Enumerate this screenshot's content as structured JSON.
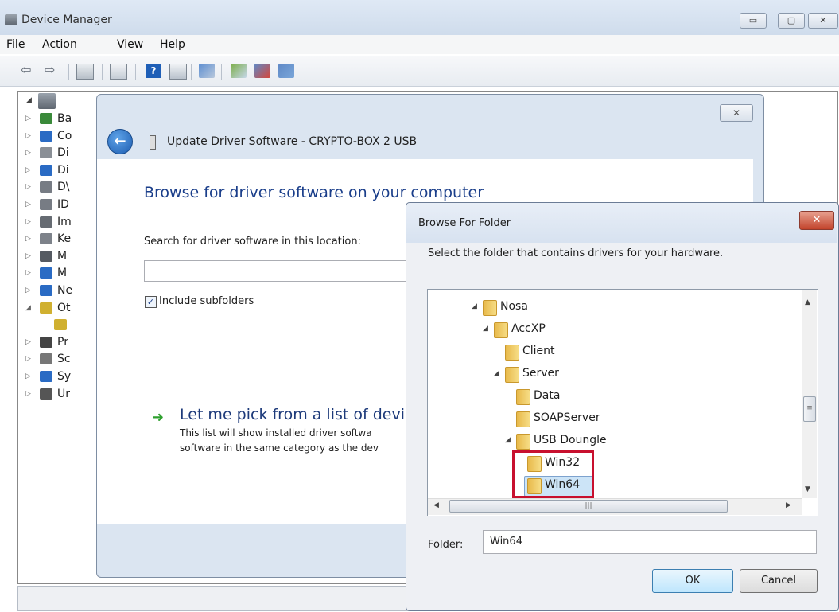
{
  "device_manager": {
    "title": "Device Manager",
    "menu": [
      "File",
      "Action",
      "View",
      "Help"
    ],
    "tree_items": [
      {
        "label": "Ba",
        "color": "#3a8a3a"
      },
      {
        "label": "Co",
        "color": "#2a6bc4"
      },
      {
        "label": "Di",
        "color": "#8a8f96"
      },
      {
        "label": "Di",
        "color": "#2a6bc4"
      },
      {
        "label": "D\\",
        "color": "#777c84"
      },
      {
        "label": "ID",
        "color": "#777c84"
      },
      {
        "label": "Im",
        "color": "#666b72"
      },
      {
        "label": "Ke",
        "color": "#7d828a"
      },
      {
        "label": "M",
        "color": "#555a62"
      },
      {
        "label": "M",
        "color": "#2a6bc4"
      },
      {
        "label": "Ne",
        "color": "#2a6bc4"
      },
      {
        "label": "Ot",
        "color": "#d0b030"
      },
      {
        "label": "",
        "color": "#d0b030"
      },
      {
        "label": "Pr",
        "color": "#444"
      },
      {
        "label": "Sc",
        "color": "#777"
      },
      {
        "label": "Sy",
        "color": "#2a6bc4"
      },
      {
        "label": "Ur",
        "color": "#555"
      }
    ]
  },
  "update_driver": {
    "title": "Update Driver Software - CRYPTO-BOX 2 USB",
    "heading": "Browse for driver software on your computer",
    "search_label": "Search for driver software in this location:",
    "include_subfolders": "Include subfolders",
    "close_glyph": "✕",
    "link_text": "Let me pick from a list of devic",
    "desc_line1": "This list will show installed driver softwa",
    "desc_line2": "software in the same category as the dev"
  },
  "browse_folder": {
    "title": "Browse For Folder",
    "instruction": "Select the folder that contains drivers for your hardware.",
    "close_glyph": "✕",
    "tree": [
      {
        "label": "Nosa",
        "expanded": true
      },
      {
        "label": "AccXP",
        "expanded": true
      },
      {
        "label": "Client",
        "expanded": false
      },
      {
        "label": "Server",
        "expanded": true
      },
      {
        "label": "Data",
        "expanded": false
      },
      {
        "label": "SOAPServer",
        "expanded": false
      },
      {
        "label": "USB Doungle",
        "expanded": true
      },
      {
        "label": "Win32",
        "expanded": false
      },
      {
        "label": "Win64",
        "expanded": false,
        "selected": true
      }
    ],
    "folder_label": "Folder:",
    "folder_value": "Win64",
    "ok_label": "OK",
    "cancel_label": "Cancel",
    "highlight_color": "#c8102e"
  }
}
